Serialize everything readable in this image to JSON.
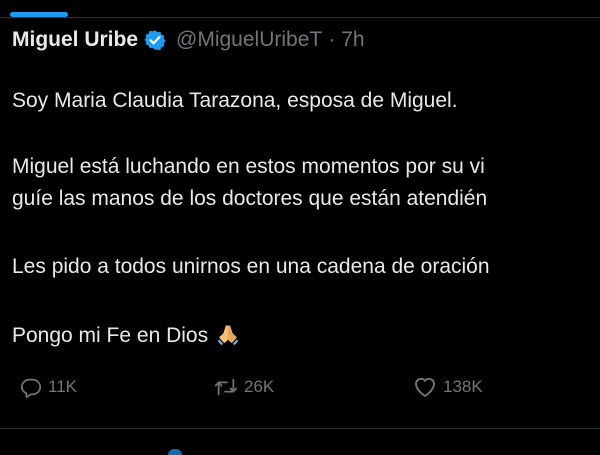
{
  "tweet": {
    "author_name": "Miguel Uribe",
    "handle": "@MiguelUribeT",
    "separator": "·",
    "time": "7h",
    "lines": [
      "Soy Maria Claudia Tarazona, esposa de Miguel.",
      "Miguel está luchando en estos momentos por su vi",
      "guíe las manos de los doctores que están atendién",
      "Les pido a todos unirnos en una cadena de oración",
      "Pongo mi Fe en Dios"
    ],
    "emoji": "folded-hands-icon",
    "actions": {
      "replies": "11K",
      "reposts": "26K",
      "likes": "138K"
    }
  },
  "colors": {
    "background": "#000000",
    "text": "#e7e9ea",
    "muted": "#71767b",
    "accent": "#1d9bf0",
    "divider": "#2f3336"
  }
}
